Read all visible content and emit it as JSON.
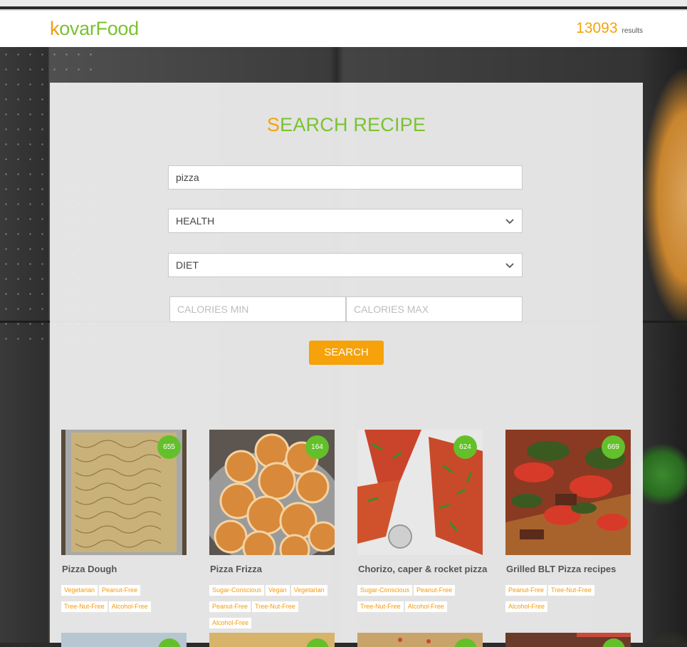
{
  "header": {
    "brand_first": "k",
    "brand_rest": "ovarFood",
    "results_count": "13093",
    "results_label": "results"
  },
  "form": {
    "title_first": "S",
    "title_rest": "EARCH RECIPE",
    "query_value": "pizza",
    "health_selected": "HEALTH",
    "diet_selected": "DIET",
    "calories_min_placeholder": "CALORIES MIN",
    "calories_max_placeholder": "CALORIES MAX",
    "search_label": "SEARCH"
  },
  "recipes": [
    {
      "title": "Pizza Dough",
      "calories": "655",
      "tags": [
        "Vegetarian",
        "Peanut-Free",
        "Tree-Nut-Free",
        "Alcohol-Free"
      ]
    },
    {
      "title": "Pizza Frizza",
      "calories": "164",
      "tags": [
        "Sugar-Conscious",
        "Vegan",
        "Vegetarian",
        "Peanut-Free",
        "Tree-Nut-Free",
        "Alcohol-Free"
      ]
    },
    {
      "title": "Chorizo, caper & rocket pizza",
      "calories": "624",
      "tags": [
        "Sugar-Conscious",
        "Peanut-Free",
        "Tree-Nut-Free",
        "Alcohol-Free"
      ]
    },
    {
      "title": "Grilled BLT Pizza recipes",
      "calories": "669",
      "tags": [
        "Peanut-Free",
        "Tree-Nut-Free",
        "Alcohol-Free"
      ]
    }
  ],
  "colors": {
    "accent_orange": "#f5a20b",
    "accent_green": "#7ac231",
    "badge_green": "#64c02a"
  }
}
